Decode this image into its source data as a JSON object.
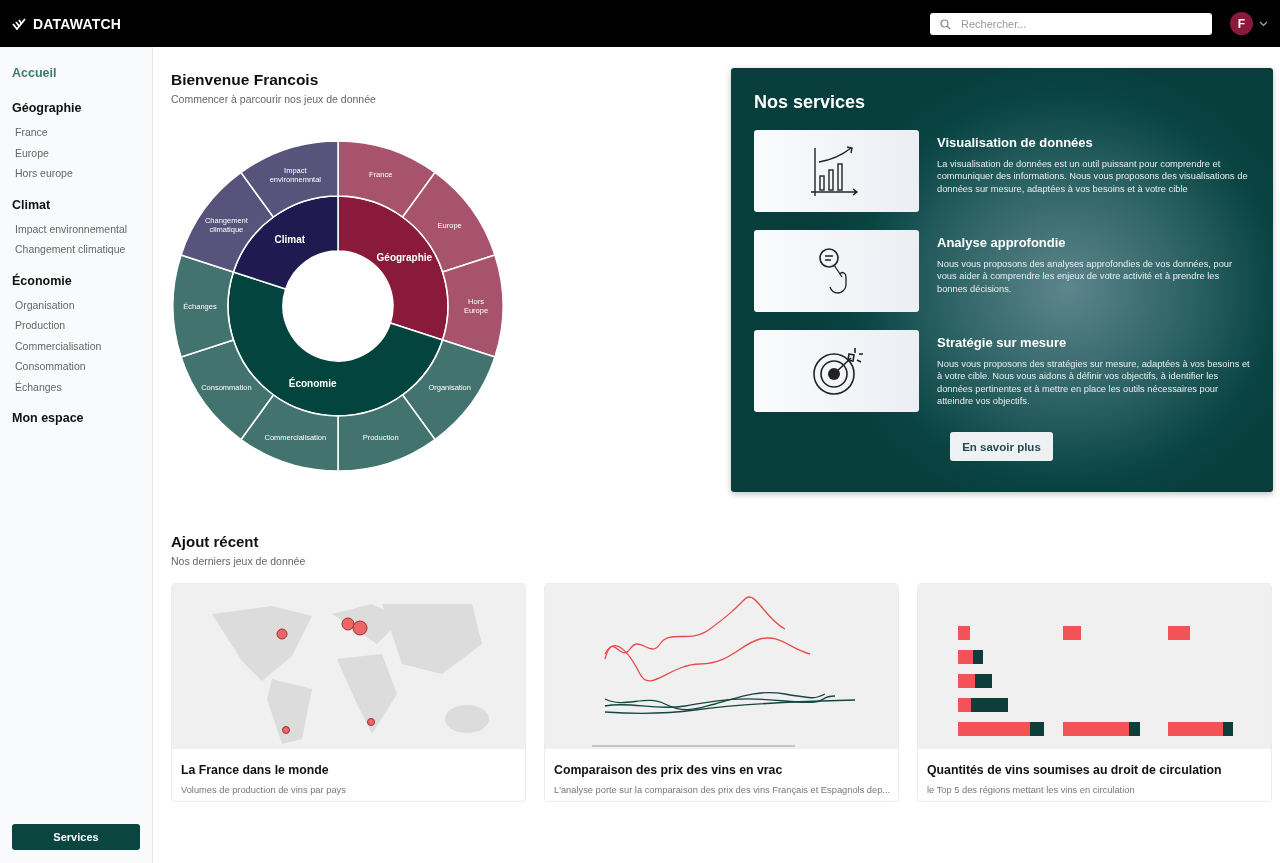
{
  "header": {
    "brand": "DATAWATCH",
    "search": {
      "placeholder": "Rechercher..."
    },
    "avatar": "F"
  },
  "sidebar": {
    "items": [
      {
        "label": "Accueil",
        "selected": true
      },
      {
        "label": "Géographie",
        "selected": false,
        "children": [
          {
            "label": "France",
            "selected": false
          },
          {
            "label": "Europe",
            "selected": false
          },
          {
            "label": "Hors europe",
            "selected": false
          }
        ]
      },
      {
        "label": "Climat",
        "selected": false,
        "children": [
          {
            "label": "Impact environnemental",
            "selected": false
          },
          {
            "label": "Changement climatique",
            "selected": false
          }
        ]
      },
      {
        "label": "Économie",
        "selected": false,
        "children": [
          {
            "label": "Organisation",
            "selected": false
          },
          {
            "label": "Production",
            "selected": false
          },
          {
            "label": "Commercialisation",
            "selected": false
          },
          {
            "label": "Consommation",
            "selected": false
          },
          {
            "label": "Échanges",
            "selected": false
          }
        ]
      },
      {
        "label": "Mon espace",
        "selected": false
      }
    ],
    "button": "Services"
  },
  "welcome": {
    "title": "Bienvenue Francois",
    "subtitle": "Commencer à parcourir nos jeux de donnée",
    "sunburst": [
      {
        "label": "Géographie",
        "color": "#8a1a3c",
        "children": [
          "France",
          "Europe",
          "Hors Europe"
        ]
      },
      {
        "label": "Économie",
        "color": "#03443f",
        "children": [
          "Organisation",
          "Production",
          "Commercialisation",
          "Consommation",
          "Échanges"
        ]
      },
      {
        "label": "Climat",
        "color": "#1f1a4f",
        "children": [
          "Changement climatique",
          "Impact environnemntal"
        ]
      }
    ]
  },
  "services": {
    "title": "Nos services",
    "items": [
      {
        "title": "Visualisation de données",
        "text": "La visualisation de données est un outil puissant pour comprendre et communiquer des informations. Nous vous proposons des visualisations de données sur mesure, adaptées à vos besoins et à votre cible"
      },
      {
        "title": "Analyse approfondie",
        "text": "Nous vous proposons des analyses approfondies de vos données, pour vous aider à comprendre les enjeux de votre activité et à prendre les bonnes décisions."
      },
      {
        "title": "Stratégie sur mesure",
        "text": "Nous vous proposons des stratégies sur mesure, adaptées à vos besoins et à votre cible. Nous vous aidons à définir vos objectifs, à identifier les données pertinentes et à mettre en place les outils nécessaires pour atteindre vos objectifs."
      }
    ],
    "button": "En savoir plus"
  },
  "recent": {
    "title": "Ajout récent",
    "subtitle": "Nos derniers jeux de donnée",
    "cards": [
      {
        "kind": "picture",
        "title": "La France dans le monde",
        "description": "Volumes de production de vins par pays"
      },
      {
        "kind": "picture",
        "title": "Comparaison des prix des vins en vrac",
        "description": "L'analyse porte sur la comparaison des prix des vins Français et Espagnols dep..."
      },
      {
        "kind": "picture",
        "title": "Quantités de vins soumises au droit de circulation",
        "description": "le Top 5 des régions mettant les vins en circulation"
      }
    ]
  }
}
